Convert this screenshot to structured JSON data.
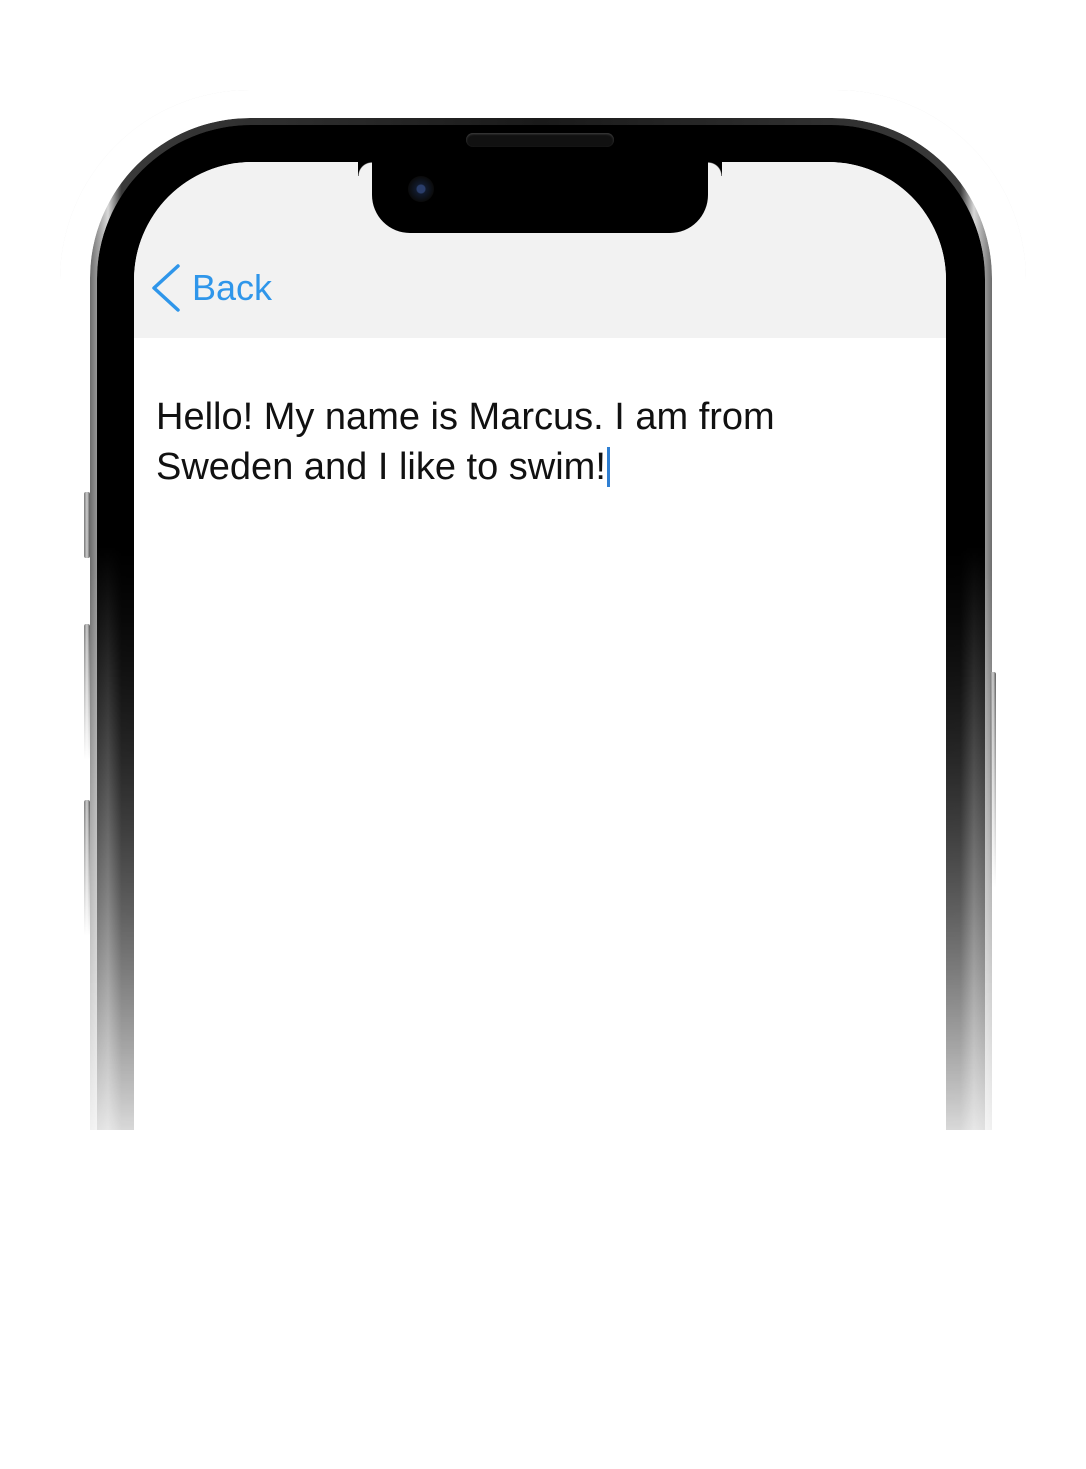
{
  "nav": {
    "back_label": "Back"
  },
  "editor": {
    "text": "Hello! My name is Marcus. I am from\nSweden and I like to swim!"
  },
  "colors": {
    "accent": "#2f96ea",
    "nav_background": "#f2f2f2",
    "text": "#111111",
    "caret": "#2f7fd2"
  },
  "icons": {
    "back": "chevron-left-icon"
  }
}
